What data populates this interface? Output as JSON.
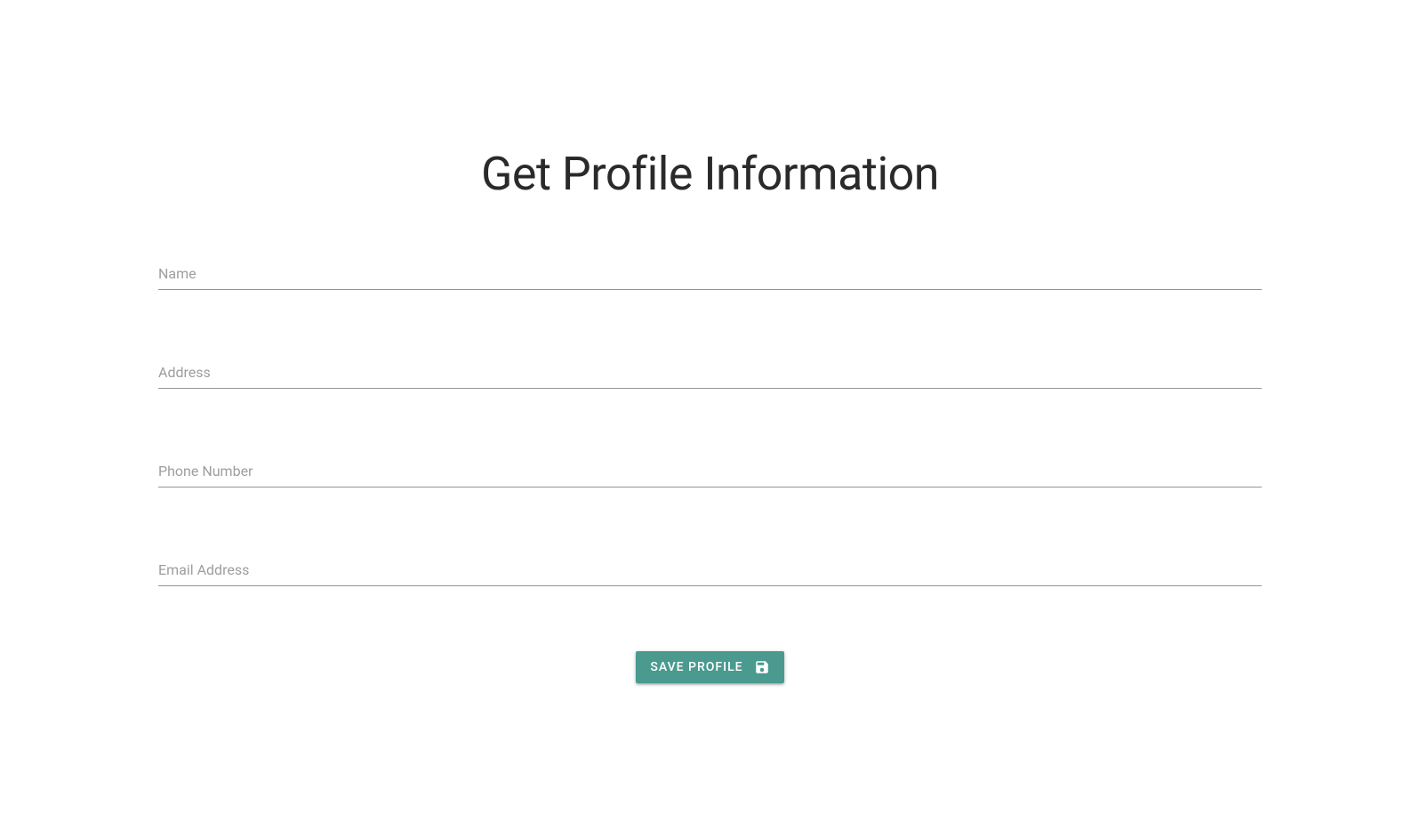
{
  "page": {
    "title": "Get Profile Information"
  },
  "form": {
    "fields": {
      "name": {
        "placeholder": "Name",
        "value": ""
      },
      "address": {
        "placeholder": "Address",
        "value": ""
      },
      "phone": {
        "placeholder": "Phone Number",
        "value": ""
      },
      "email": {
        "placeholder": "Email Address",
        "value": ""
      }
    },
    "button": {
      "label": "SAVE PROFILE"
    }
  },
  "colors": {
    "accent": "#4a9a8f",
    "text": "#2a2a2a",
    "placeholder": "#9e9e9e"
  }
}
